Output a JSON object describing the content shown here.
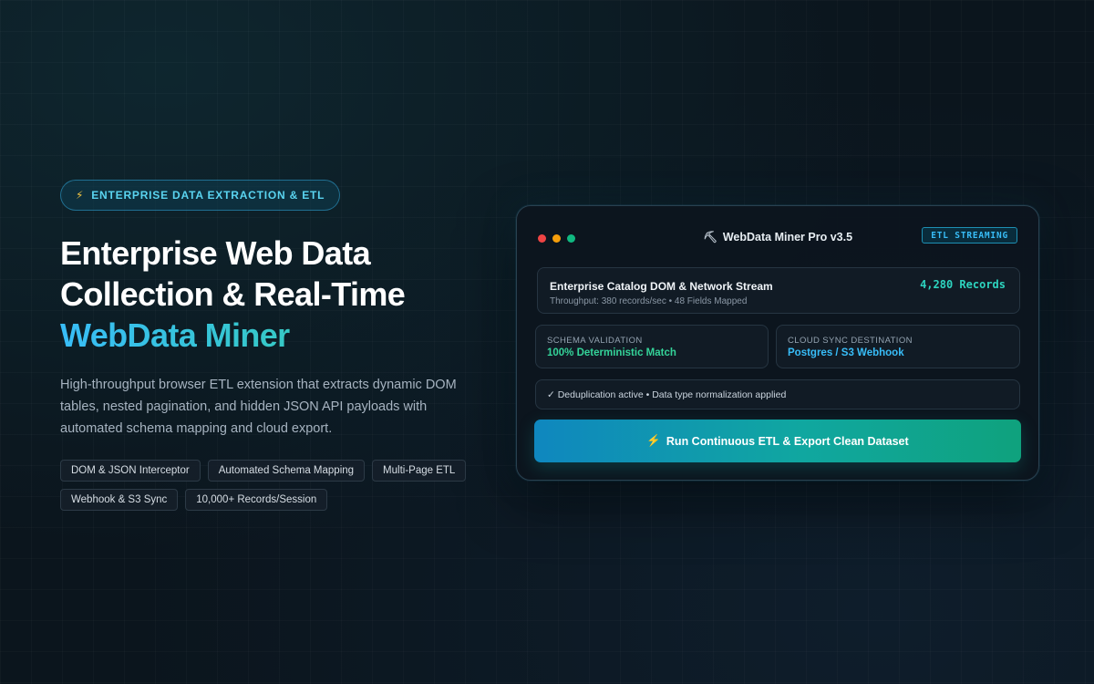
{
  "hero": {
    "badge_icon": "⚡",
    "badge_text": "ENTERPRISE DATA EXTRACTION & ETL",
    "title_line1": "Enterprise Web Data",
    "title_line2": "Collection & Real-Time",
    "title_accent": "WebData Miner",
    "description": "High-throughput browser ETL extension that extracts dynamic DOM tables, nested pagination, and hidden JSON API payloads with automated schema mapping and cloud export.",
    "tags": [
      "DOM & JSON Interceptor",
      "Automated Schema Mapping",
      "Multi-Page ETL",
      "Webhook & S3 Sync",
      "10,000+ Records/Session"
    ]
  },
  "window": {
    "title_icon": "⛏",
    "title": "WebData Miner Pro v3.5",
    "status_badge": "ETL STREAMING",
    "stream": {
      "name": "Enterprise Catalog DOM & Network Stream",
      "meta": "Throughput: 380 records/sec • 48 Fields Mapped",
      "count": "4,280 Records"
    },
    "schema": {
      "label": "SCHEMA VALIDATION",
      "value": "100% Deterministic Match"
    },
    "cloud": {
      "label": "CLOUD SYNC DESTINATION",
      "value": "Postgres / S3 Webhook"
    },
    "note": "✓ Deduplication active • Data type normalization applied",
    "run_button_icon": "⚡",
    "run_button": "Run Continuous ETL & Export Clean Dataset"
  },
  "colors": {
    "accent_blue": "#38bdf8",
    "accent_green": "#34d399",
    "background": "#0b151d"
  }
}
